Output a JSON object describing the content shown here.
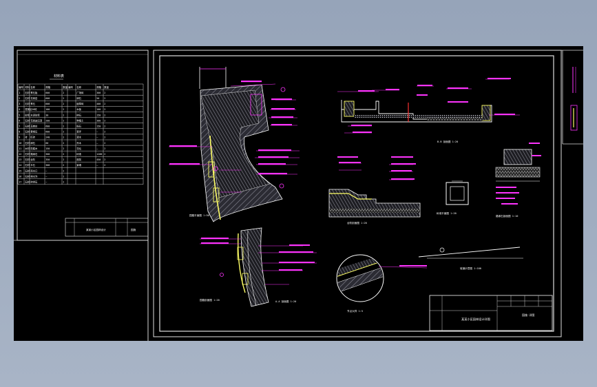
{
  "sheet": {
    "main_title": "某某小区园林设计详图",
    "sheet_no": "园施-详图"
  },
  "material_table": {
    "title": "材料表",
    "headers": [
      "编号",
      "材料",
      "名称",
      "规格",
      "数量",
      "编号",
      "名称",
      "规格",
      "数量"
    ],
    "rows": [
      [
        "1",
        "石材",
        "青石板",
        "600",
        "2",
        "广场砖",
        "300",
        "2"
      ],
      [
        "2",
        "石材",
        "花岗岩",
        "600",
        "2",
        "卵石",
        "50",
        "2"
      ],
      [
        "3",
        "石材",
        "青石",
        "600",
        "2",
        "嵌草砖",
        "400",
        "2"
      ],
      [
        "4",
        "混凝土",
        "C20砼",
        "100",
        "2",
        "木板",
        "100",
        "2"
      ],
      [
        "5",
        "砂浆",
        "水泥砂浆",
        "30",
        "2",
        "碎石",
        "150",
        "2"
      ],
      [
        "6",
        "石材",
        "花岗岩压顶",
        "200",
        "2",
        "种植土",
        "300",
        "2"
      ],
      [
        "7",
        "石材",
        "芝麻灰",
        "600",
        "2",
        "砾石",
        "150",
        "2"
      ],
      [
        "8",
        "石材",
        "黄锈石",
        "600",
        "2",
        "草坪",
        "—",
        "2"
      ],
      [
        "9",
        "砖",
        "红砖",
        "240",
        "2",
        "灌木",
        "—",
        "2"
      ],
      [
        "10",
        "石材",
        "卵石",
        "60",
        "2",
        "乔木",
        "—",
        "2"
      ],
      [
        "11",
        "木材",
        "防腐木",
        "150",
        "2",
        "花坛",
        "—",
        "2"
      ],
      [
        "12",
        "石材",
        "路缘石",
        "300",
        "2",
        "树池",
        "1200",
        "2"
      ],
      [
        "13",
        "石材",
        "台阶",
        "350",
        "2",
        "座凳",
        "450",
        "2"
      ],
      [
        "14",
        "石材",
        "平石",
        "300",
        "2",
        "景墙",
        "—",
        "2"
      ],
      [
        "15",
        "石材",
        "雨水口",
        "—",
        "2",
        "",
        "",
        ""
      ],
      [
        "16",
        "石材",
        "排水沟",
        "—",
        "2",
        "",
        "",
        ""
      ],
      [
        "17",
        "石材",
        "碎拼石",
        "—",
        "2",
        "",
        "",
        ""
      ]
    ],
    "stamp_left": "某某小区园林设计",
    "stamp_right": "园施"
  },
  "details": {
    "plan": "园路平面图  1:50",
    "plan_section": "园路剖面图  1:20",
    "section_a": "A-A 剖面图  1:20",
    "section_b": "B-B 剖面图  1:20",
    "section_c": "台阶剖面图  1:20",
    "pool": "树池平面图  1:20",
    "curb": "路缘石剖面图  1:10",
    "slope": "坡道示意图  1:100",
    "node": "节点大样  1:5"
  }
}
